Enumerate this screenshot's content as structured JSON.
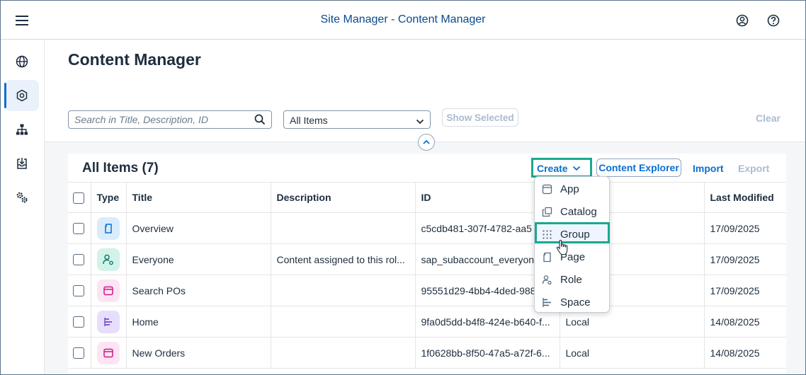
{
  "shell": {
    "title": "Site Manager - Content Manager"
  },
  "page": {
    "title": "Content Manager"
  },
  "filters": {
    "search_placeholder": "Search in Title, Description, ID",
    "select_value": "All Items",
    "show_selected": "Show Selected",
    "clear": "Clear"
  },
  "panel": {
    "title": "All Items (7)",
    "create": "Create",
    "content_explorer": "Content Explorer",
    "import": "Import",
    "export": "Export"
  },
  "table": {
    "headers": [
      "Type",
      "Title",
      "Description",
      "ID",
      "",
      "Last Modified"
    ],
    "rows": [
      {
        "type_icon": "page-icon",
        "title": "Overview",
        "description": "",
        "id": "c5cdb481-307f-4782-aa5",
        "provider": "",
        "modified": "17/09/2025"
      },
      {
        "type_icon": "role-icon",
        "title": "Everyone",
        "description": "Content assigned to this rol...",
        "id": "sap_subaccount_everyone",
        "provider": "",
        "modified": "17/09/2025"
      },
      {
        "type_icon": "app-icon",
        "title": "Search POs",
        "description": "",
        "id": "95551d29-4bb4-4ded-988",
        "provider": "",
        "modified": "17/09/2025"
      },
      {
        "type_icon": "space-icon",
        "title": "Home",
        "description": "",
        "id": "9fa0d5dd-b4f8-424e-b640-f...",
        "provider": "Local",
        "modified": "14/08/2025"
      },
      {
        "type_icon": "app-icon",
        "title": "New Orders",
        "description": "",
        "id": "1f0628bb-8f50-47a5-a72f-6...",
        "provider": "Local",
        "modified": "14/08/2025"
      }
    ]
  },
  "create_menu": {
    "items": [
      "App",
      "Catalog",
      "Group",
      "Page",
      "Role",
      "Space"
    ],
    "highlighted": "Group"
  },
  "colors": {
    "accent": "#0a6ed1",
    "highlight_border": "#1aa88f",
    "page_type_bg": "#d9ecfc",
    "role_type_bg": "#d2f2ea",
    "app_type_bg": "#fde4f3",
    "space_type_bg": "#e7defb"
  }
}
